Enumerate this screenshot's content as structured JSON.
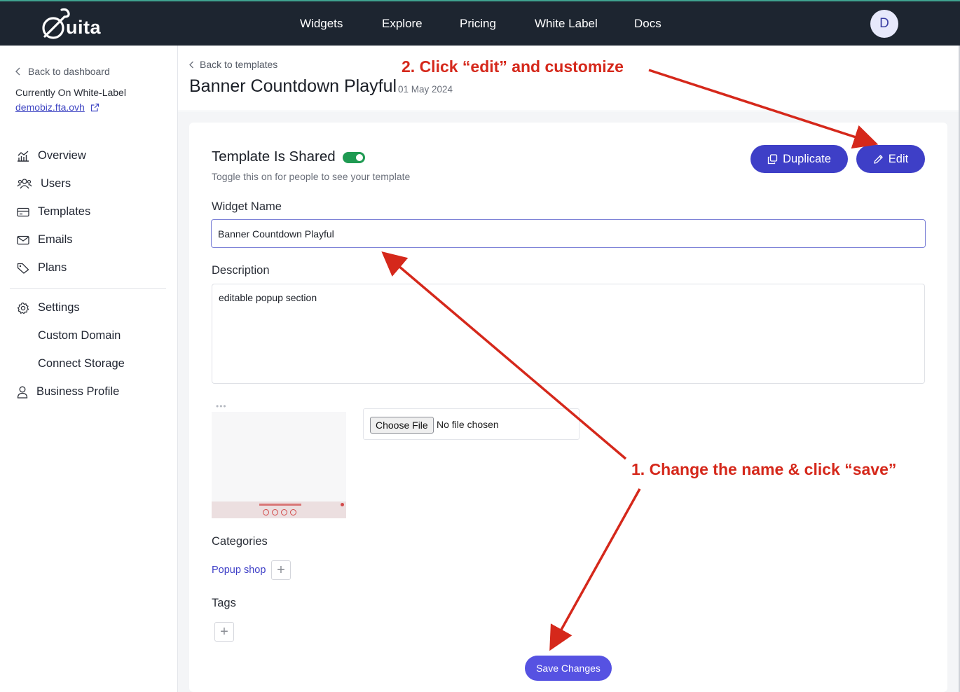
{
  "topbar": {
    "logo_text": "uita",
    "nav": [
      "Widgets",
      "Explore",
      "Pricing",
      "White Label",
      "Docs"
    ],
    "avatar_initial": "D"
  },
  "sidebar": {
    "back_label": "Back to dashboard",
    "current_label": "Currently On White-Label",
    "domain": "demobiz.fta.ovh",
    "items": [
      {
        "label": "Overview",
        "icon": "chart-icon"
      },
      {
        "label": "Users",
        "icon": "users-icon"
      },
      {
        "label": "Templates",
        "icon": "card-icon"
      },
      {
        "label": "Emails",
        "icon": "mail-icon"
      },
      {
        "label": "Plans",
        "icon": "tag-icon"
      }
    ],
    "settings": {
      "label": "Settings",
      "icon": "gear-icon",
      "sub_items": [
        "Custom Domain",
        "Connect Storage"
      ]
    },
    "profile": {
      "label": "Business Profile",
      "icon": "user-icon"
    }
  },
  "header": {
    "back_label": "Back to templates",
    "title": "Banner Countdown Playful",
    "date": "01 May 2024"
  },
  "form": {
    "shared_title": "Template Is Shared",
    "shared_on": true,
    "shared_hint": "Toggle this on for people to see your template",
    "duplicate_label": "Duplicate",
    "edit_label": "Edit",
    "name_label": "Widget Name",
    "name_value": "Banner Countdown Playful",
    "description_label": "Description",
    "description_value": "editable popup section",
    "file_button": "Choose File",
    "file_status": "No file chosen",
    "categories_label": "Categories",
    "categories": [
      "Popup shop"
    ],
    "tags_label": "Tags",
    "save_label": "Save Changes"
  },
  "annotations": {
    "step1": "1. Change the name & click “save”",
    "step2": "2. Click “edit” and customize",
    "color": "#d5281b"
  },
  "colors": {
    "topbar": "#1d2530",
    "primary": "#3e3fc7",
    "toggle_on": "#1f9a52"
  }
}
